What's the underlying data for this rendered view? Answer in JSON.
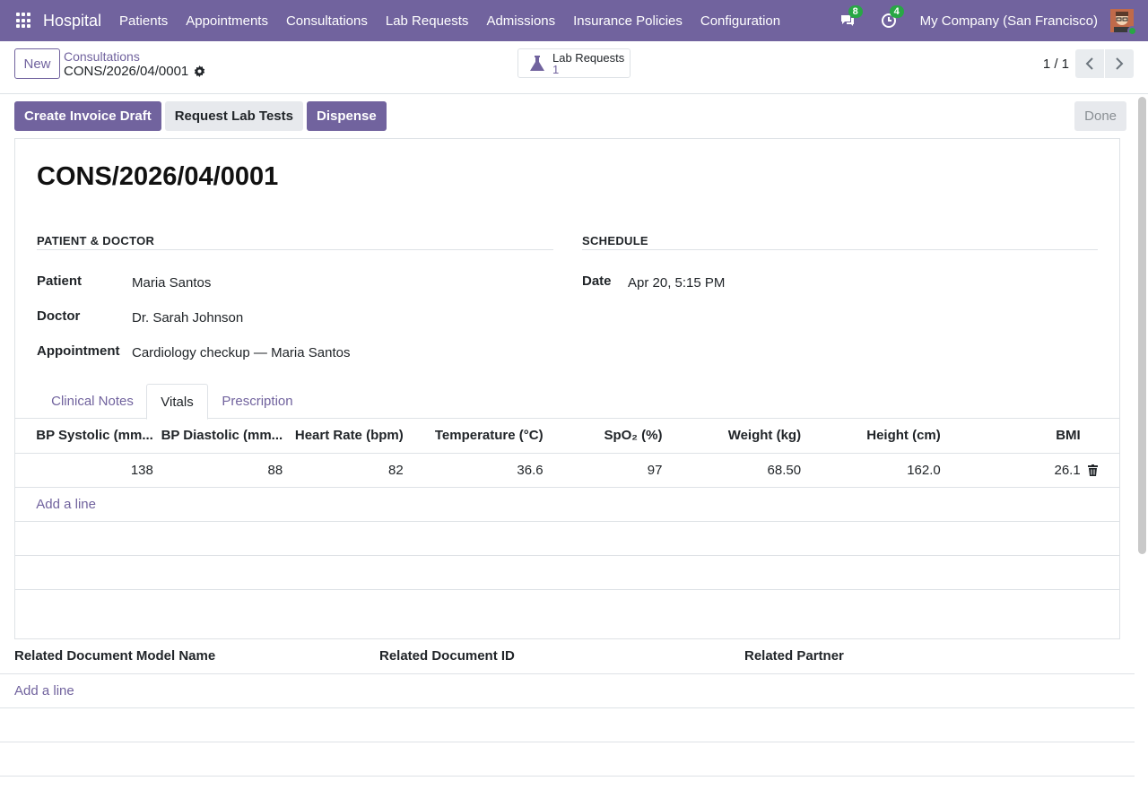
{
  "navbar": {
    "brand": "Hospital",
    "menu": [
      "Patients",
      "Appointments",
      "Consultations",
      "Lab Requests",
      "Admissions",
      "Insurance Policies",
      "Configuration"
    ],
    "messages_count": "8",
    "activities_count": "4",
    "company": "My Company (San Francisco)"
  },
  "control": {
    "new_label": "New",
    "breadcrumb_parent": "Consultations",
    "breadcrumb_current": "CONS/2026/04/0001",
    "smart_button": {
      "label": "Lab Requests",
      "value": "1"
    },
    "pager": "1 / 1"
  },
  "actions": {
    "create_invoice": "Create Invoice Draft",
    "request_lab": "Request Lab Tests",
    "dispense": "Dispense",
    "done": "Done"
  },
  "form": {
    "title": "CONS/2026/04/0001",
    "group_patient": "PATIENT & DOCTOR",
    "group_schedule": "SCHEDULE",
    "patient_label": "Patient",
    "patient_value": "Maria Santos",
    "doctor_label": "Doctor",
    "doctor_value": "Dr. Sarah Johnson",
    "appointment_label": "Appointment",
    "appointment_value": "Cardiology checkup — Maria Santos",
    "date_label": "Date",
    "date_value": "Apr 20, 5:15 PM"
  },
  "tabs": [
    "Clinical Notes",
    "Vitals",
    "Prescription"
  ],
  "vitals": {
    "headers": [
      "BP Systolic (mm...",
      "BP Diastolic (mm...",
      "Heart Rate (bpm)",
      "Temperature (°C)",
      "SpO₂ (%)",
      "Weight (kg)",
      "Height (cm)",
      "BMI"
    ],
    "row": [
      "138",
      "88",
      "82",
      "36.6",
      "97",
      "68.50",
      "162.0",
      "26.1"
    ],
    "add_line": "Add a line"
  },
  "related": {
    "headers": [
      "Related Document Model Name",
      "Related Document ID",
      "Related Partner"
    ],
    "add_line": "Add a line"
  }
}
